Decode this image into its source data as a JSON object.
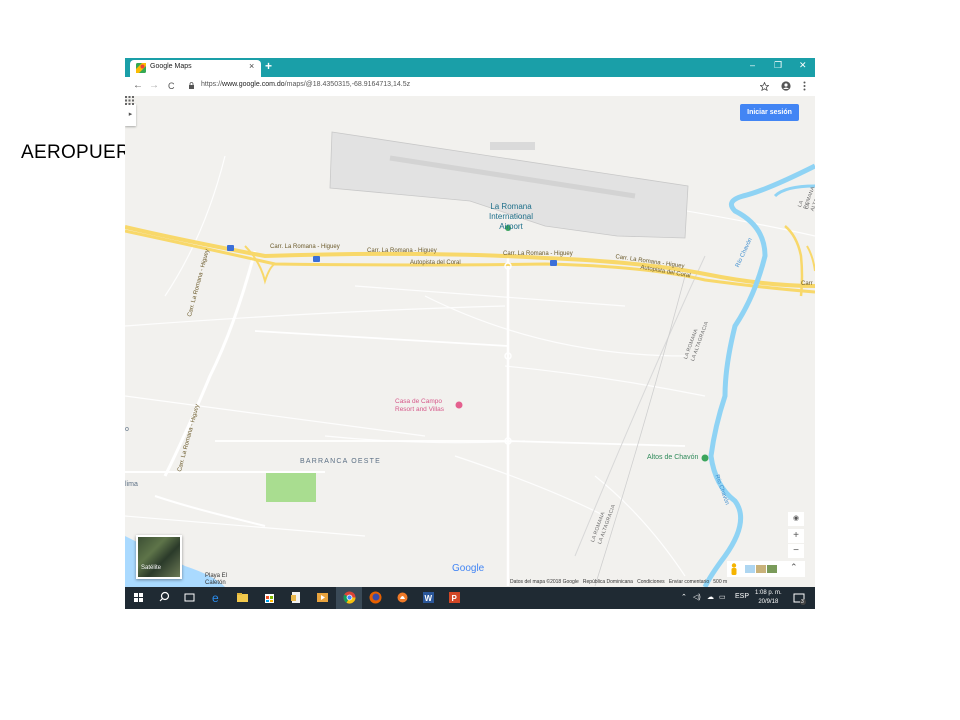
{
  "slide": {
    "title": "AEROPUERTO"
  },
  "browser": {
    "tab_title": "Google Maps",
    "tab_close": "×",
    "new_tab": "+",
    "win_min": "–",
    "win_max": "❐",
    "win_close": "✕",
    "back": "←",
    "forward": "→",
    "reload": "C",
    "url_prefix": "https://",
    "url_host": "www.google.com.do",
    "url_path": "/maps/@18.4350315,-68.9164713,14.5z"
  },
  "map": {
    "signin_label": "Iniciar sesión",
    "collapse_label": "▸",
    "satellite_label": "Satélite",
    "labels": {
      "airport_l1": "La Romana",
      "airport_l2": "International",
      "airport_l3": "Airport",
      "road1": "Carr. La Romana - Higuey",
      "road2": "Carr. La Romana - Higuey",
      "road3": "Carr. La Romana - Higuey",
      "road4": "Carr. La Romana - Higuey",
      "autopista1": "Autopista del Coral",
      "autopista2": "Autopista del Coral",
      "carr_west": "Carr. La Romana - Higuey",
      "carr_west2": "Carr. La Romana - Higuey",
      "carr_east": "Carr",
      "rio_chavon1": "Río Chavón",
      "rio_chavon2": "Río Chavón",
      "la_romana_ne": "LA ROMANA",
      "la_altagracia_ne": "LA ALTAGRACIA",
      "la_romana_mid": "LA ROMANA",
      "la_altagracia_mid": "LA ALTAGRACIA",
      "la_romana_s": "LA ROMANA",
      "la_altagracia_s": "LA ALTAGRACIA",
      "casa_l1": "Casa de Campo",
      "casa_l2": "Resort and Villas",
      "barranca": "BARRANCA OESTE",
      "altos": "Altos de Chavón",
      "playa_l1": "Playa El",
      "playa_l2": "Caletón",
      "edge_o": "o",
      "edge_e": "e",
      "edge_lima": "lima"
    },
    "google_logo": "Google",
    "attribution": [
      "Datos del mapa ©2018 Google",
      "República Dominicana",
      "Condiciones",
      "Enviar comentario",
      "500 m"
    ],
    "zoom_in": "+",
    "zoom_out": "−",
    "locate": "◉",
    "expand": "⌃"
  },
  "taskbar": {
    "lang": "ESP",
    "time": "1:08 p. m.",
    "date": "20/9/18",
    "notif": "3"
  },
  "colors": {
    "chrome_tabbar": "#1a9fa8",
    "signin": "#4285f4",
    "highway": "#f8d86a",
    "river": "#8fd3f4",
    "taskbar": "#1f2a33"
  }
}
